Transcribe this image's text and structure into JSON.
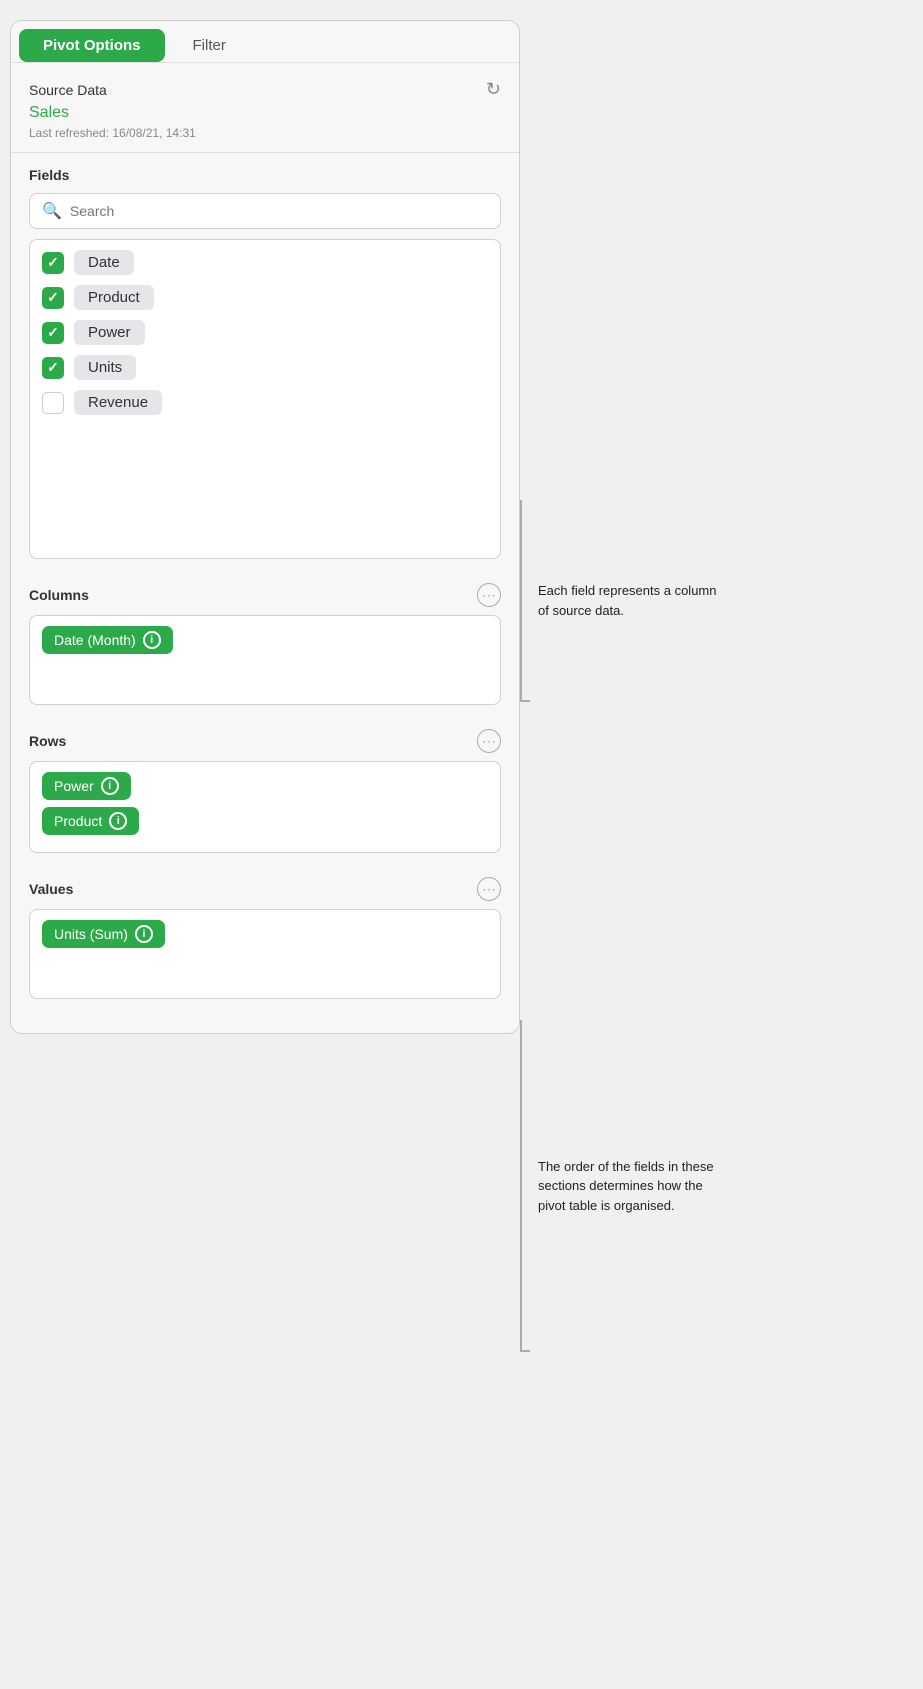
{
  "tabs": {
    "active": "Pivot Options",
    "inactive": "Filter"
  },
  "source": {
    "label": "Source Data",
    "name": "Sales",
    "last_refreshed": "Last refreshed: 16/08/21, 14:31",
    "refresh_icon": "↻"
  },
  "fields": {
    "section_title": "Fields",
    "search_placeholder": "Search",
    "items": [
      {
        "label": "Date",
        "checked": true
      },
      {
        "label": "Product",
        "checked": true
      },
      {
        "label": "Power",
        "checked": true
      },
      {
        "label": "Units",
        "checked": true
      },
      {
        "label": "Revenue",
        "checked": false
      }
    ]
  },
  "columns": {
    "section_title": "Columns",
    "tags": [
      {
        "label": "Date (Month)"
      }
    ]
  },
  "rows": {
    "section_title": "Rows",
    "tags": [
      {
        "label": "Power"
      },
      {
        "label": "Product"
      }
    ]
  },
  "values": {
    "section_title": "Values",
    "tags": [
      {
        "label": "Units (Sum)"
      }
    ]
  },
  "annotations": {
    "fields_note": "Each field represents a column of source data.",
    "rows_note": "The order of the fields in these sections determines how the pivot table is organised."
  },
  "more_icon_label": "⋯",
  "info_icon_label": "i"
}
